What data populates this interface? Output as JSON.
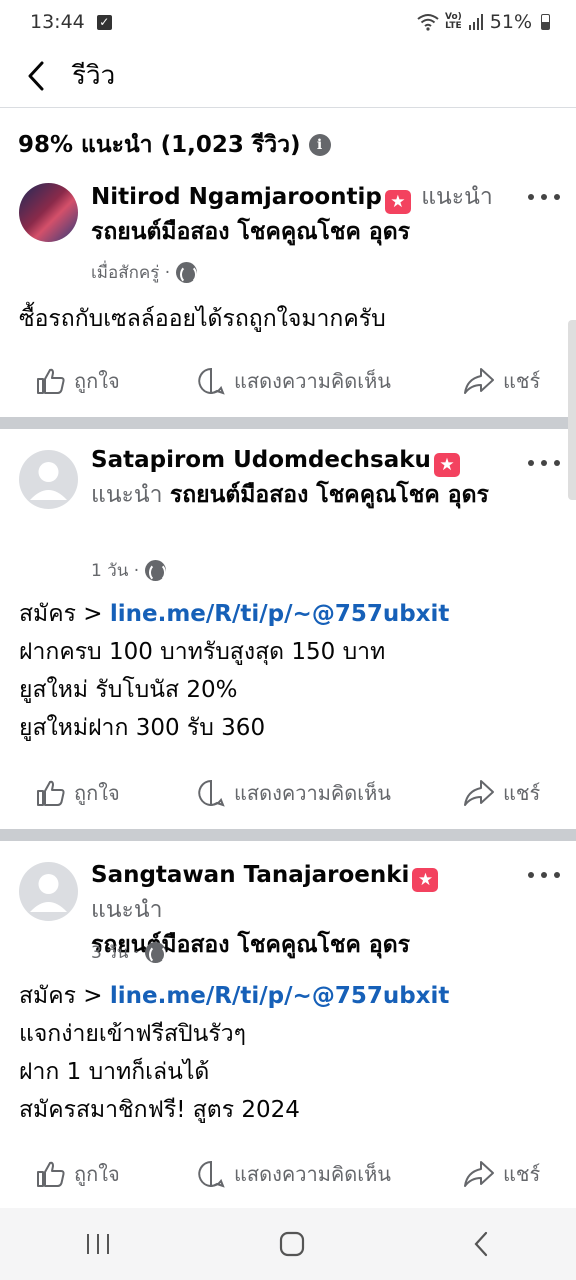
{
  "status_bar": {
    "time": "13:44",
    "battery": "51%",
    "volte_top": "Vo)",
    "volte_bottom": "LTE"
  },
  "header": {
    "title": "รีวิว"
  },
  "summary": {
    "text": "98% แนะนำ (1,023 รีวิว)"
  },
  "reviews": [
    {
      "name": "Nitirod Ngamjaroontip",
      "recommends": "แนะนำ",
      "page": "รถยนต์มือสอง โชคคูณโชค อุดร",
      "time": "เมื่อสักครู่ ·",
      "lines": [
        "ซื้อรถกับเซลล์ออยได้รถถูกใจมากครับ"
      ]
    },
    {
      "name": "Satapirom Udomdechsaku",
      "recommends": "แนะนำ",
      "page": "รถยนต์มือสอง โชคคูณโชค อุดร",
      "time": "1 วัน ·",
      "link_prefix": "สมัคร > ",
      "link": "line.me/R/ti/p/~@757ubxit",
      "lines": [
        "ฝากครบ 100 บาทรับสูงสุด 150 บาท",
        "ยูสใหม่ รับโบนัส 20%",
        "ยูสใหม่ฝาก 300 รับ 360"
      ]
    },
    {
      "name": "Sangtawan Tanajaroenki",
      "recommends": "แนะนำ",
      "page": "รถยนต์มือสอง โชคคูณโชค อุดร",
      "time": "3 วัน ·",
      "link_prefix": "สมัคร > ",
      "link": "line.me/R/ti/p/~@757ubxit",
      "lines": [
        "แจกง่ายเข้าฟรีสปินรัวๆ",
        "ฝาก 1 บาทก็เล่นได้",
        "สมัครสมาชิกฟรี! สูตร 2024"
      ]
    }
  ],
  "actions": {
    "like": "ถูกใจ",
    "comment": "แสดงความคิดเห็น",
    "share": "แชร์"
  },
  "colors": {
    "accent_link": "#1660b8",
    "badge": "#f3425f",
    "muted": "#65676b"
  }
}
